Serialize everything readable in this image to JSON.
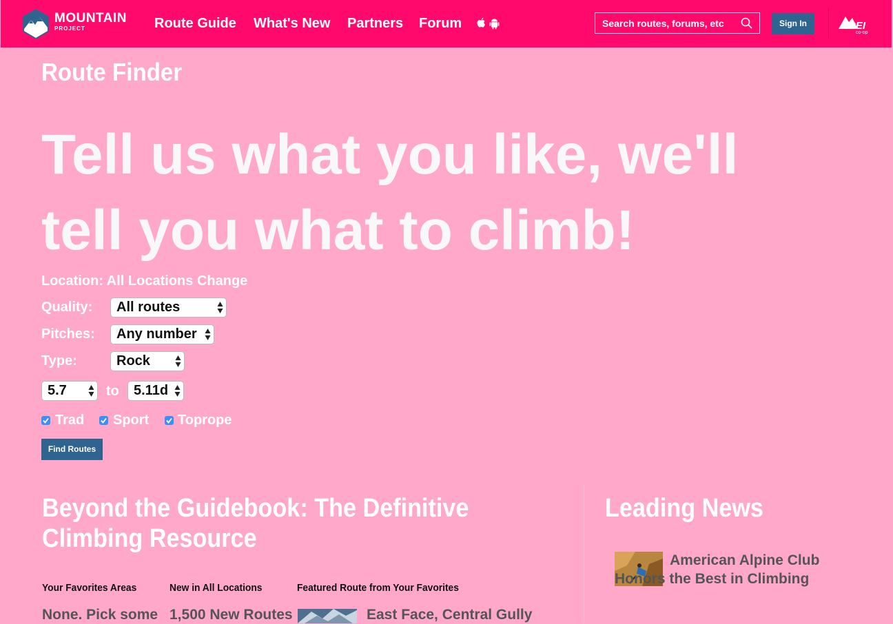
{
  "header": {
    "logo_word": "MOUNTAIN",
    "logo_sub": "PROJECT",
    "nav": [
      "Route Guide",
      "What's New",
      "Partners",
      "Forum"
    ],
    "search_placeholder": "Search routes, forums, etc",
    "signin_label": "Sign In",
    "partner_logo": "REI co-op",
    "brand_color": "#ff0a6c",
    "button_color": "#2f6390"
  },
  "route_finder": {
    "title": "Route Finder",
    "hero_line1": "Tell us what you like, we'll",
    "hero_line2": "tell you what to climb!",
    "location_label": "Location: All Locations",
    "location_change": "Change",
    "quality_label": "Quality:",
    "quality_value": "All routes",
    "pitches_label": "Pitches:",
    "pitches_value": "Any number",
    "type_label": "Type:",
    "type_value": "Rock",
    "grade_from": "5.7",
    "grade_to_label": "to",
    "grade_to": "5.11d",
    "checkboxes": [
      {
        "label": "Trad",
        "checked": true
      },
      {
        "label": "Sport",
        "checked": true
      },
      {
        "label": "Toprope",
        "checked": true
      }
    ],
    "find_button": "Find Routes"
  },
  "guidebook": {
    "title_line1": "Beyond the Guidebook: The Definitive",
    "title_line2": "Climbing Resource",
    "columns": [
      {
        "heading": "Your Favorites Areas",
        "value": "None. Pick some"
      },
      {
        "heading": "New in All Locations",
        "value": "1,500 New Routes"
      },
      {
        "heading": "Featured Route from Your Favorites",
        "value": "East Face, Central Gully"
      }
    ]
  },
  "news": {
    "title": "Leading News",
    "items": [
      {
        "title": "American Alpine Club Honors the Best in Climbing"
      }
    ]
  }
}
